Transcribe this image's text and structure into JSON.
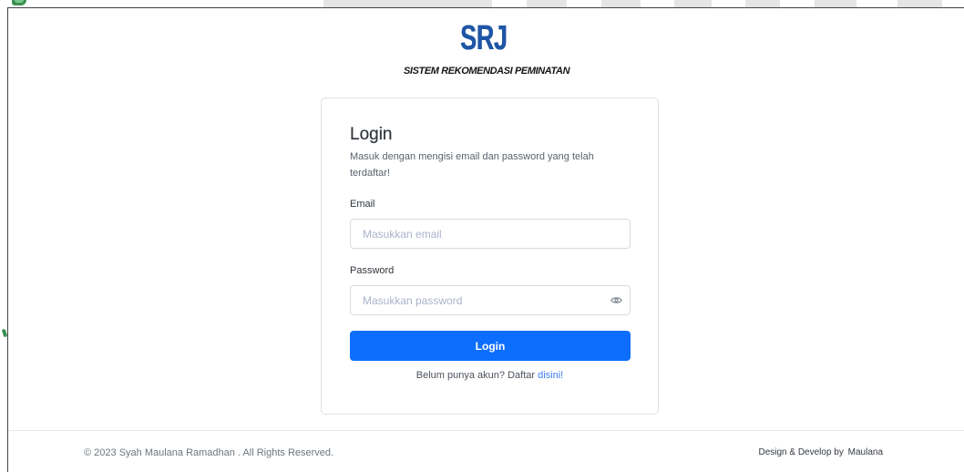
{
  "brand": {
    "logo_text": "SRJ",
    "tagline": "SISTEM REKOMENDASI PEMINATAN"
  },
  "login_card": {
    "title": "Login",
    "subtitle": "Masuk dengan mengisi email dan password yang telah terdaftar!",
    "email": {
      "label": "Email",
      "placeholder": "Masukkan email",
      "value": ""
    },
    "password": {
      "label": "Password",
      "placeholder": "Masukkan password",
      "value": "",
      "toggle_icon": "eye-icon"
    },
    "submit_label": "Login",
    "register": {
      "prompt": "Belum punya akun? Daftar",
      "link_label": "disini!"
    }
  },
  "footer": {
    "copyright": "© 2023 Syah Maulana Ramadhan . All Rights Reserved.",
    "credit_prefix": "Design & Develop by",
    "credit_author": "Maulana"
  },
  "theme": {
    "logo_color": "#1f55a5",
    "primary_color": "#0d6efd",
    "link_color": "#3b7cf6",
    "heading_color": "#343a40",
    "muted_text_color": "#6c757d",
    "placeholder_color": "#a9b3cb",
    "border_color": "#dee2e6",
    "background_accent": "#3b8f50"
  }
}
